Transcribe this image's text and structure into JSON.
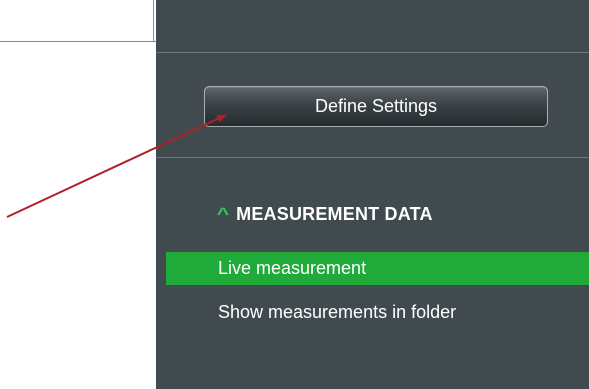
{
  "panel": {
    "define_settings_label": "Define Settings",
    "section": {
      "chevron_icon": "chevron-up-icon",
      "title": "MEASUREMENT DATA"
    },
    "items": [
      {
        "label": "Live measurement",
        "active": true
      },
      {
        "label": "Show measurements in folder",
        "active": false
      }
    ]
  },
  "annotation": {
    "arrow_color": "#b0202a"
  },
  "colors": {
    "panel_bg": "#414a4f",
    "active_item_bg": "#1faa3a",
    "chevron": "#2ecc52"
  }
}
